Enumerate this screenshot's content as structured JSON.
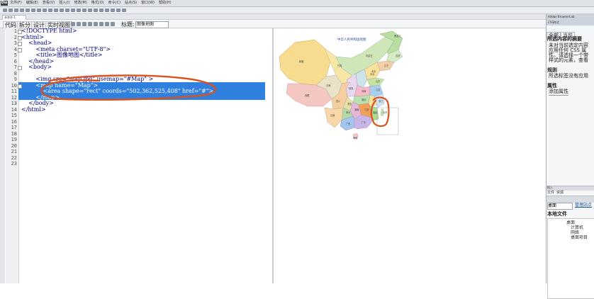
{
  "app": {
    "logo": "Dw",
    "menus": [
      "文件(F)",
      "编辑(E)",
      "查看(V)",
      "插入(I)",
      "修改(M)",
      "格式(O)",
      "命令(C)",
      "站点(S)",
      "窗口(W)",
      "帮助(H)"
    ]
  },
  "document": {
    "tab_label": "未命名-1"
  },
  "view_bar": {
    "buttons": [
      "代码",
      "拆分",
      "设计",
      "实时视图"
    ],
    "title_label": "标题:",
    "title_value": "图像地图"
  },
  "code": {
    "lines": [
      {
        "n": "1",
        "text": "<!DOCTYPE html>"
      },
      {
        "n": "2",
        "text": "<html>"
      },
      {
        "n": "3",
        "text": "    <head>"
      },
      {
        "n": "4",
        "text": "        <meta charset=\"UTF-8\">"
      },
      {
        "n": "5",
        "text": "        <title>图像地图</title>"
      },
      {
        "n": "6",
        "text": "    </head>"
      },
      {
        "n": "7",
        "text": "    <body>"
      },
      {
        "n": "8",
        "text": ""
      },
      {
        "n": "9",
        "text": "        <img src=\"map.jpg\" usemap=\"#Map\" >"
      },
      {
        "n": "10",
        "text": "        <map name=\"Map\">"
      },
      {
        "n": "11",
        "text": "            <area shape=\"rect\" coords=\"502,362,525,408\" href=\"#\">"
      },
      {
        "n": "12",
        "text": "        </map>"
      },
      {
        "n": "13",
        "text": "    </body>"
      },
      {
        "n": "14",
        "text": "</html>"
      },
      {
        "n": "15",
        "text": ""
      },
      {
        "n": "16",
        "text": ""
      },
      {
        "n": "17",
        "text": ""
      },
      {
        "n": "18",
        "text": ""
      },
      {
        "n": "19",
        "text": ""
      },
      {
        "n": "20",
        "text": ""
      },
      {
        "n": "21",
        "text": ""
      },
      {
        "n": "22",
        "text": ""
      },
      {
        "n": "23",
        "text": ""
      }
    ]
  },
  "map": {
    "title": "中华人民共和国地图",
    "labels": [
      "黑龙江",
      "吉林",
      "辽宁",
      "内蒙古",
      "北京",
      "河北",
      "新疆",
      "西藏",
      "青海",
      "甘肃",
      "四川",
      "云南",
      "广西",
      "广东",
      "湖南",
      "湖北",
      "江西",
      "福建",
      "浙江",
      "江苏",
      "山东",
      "河南",
      "陕西",
      "贵州",
      "重庆",
      "台湾",
      "海南"
    ]
  },
  "right_panel": {
    "header": "Adobe BrowserLab",
    "sub_header": "CSS样式",
    "tabs": [
      "全部",
      "当前"
    ],
    "section_title": "所选内容的摘要",
    "summary": [
      "未对当前选定内容",
      "应用任何 CSS 属",
      "性。请选择一个带",
      "样式的元素，查看"
    ],
    "rules_title": "规则",
    "rules_text": "所选标签没有应用",
    "props_title": "属性",
    "props_text": "添加属性",
    "files_header": "插入",
    "files_tabs": [
      "文件",
      "资源"
    ],
    "site_select": "桌面",
    "manage_link": "管理站点",
    "local_files_title": "本地文件",
    "tree": [
      "桌面",
      "计算机",
      "网络",
      "桌面项目"
    ]
  },
  "colors": {
    "selection": "#3080e0",
    "annotation": "#d9531e"
  }
}
